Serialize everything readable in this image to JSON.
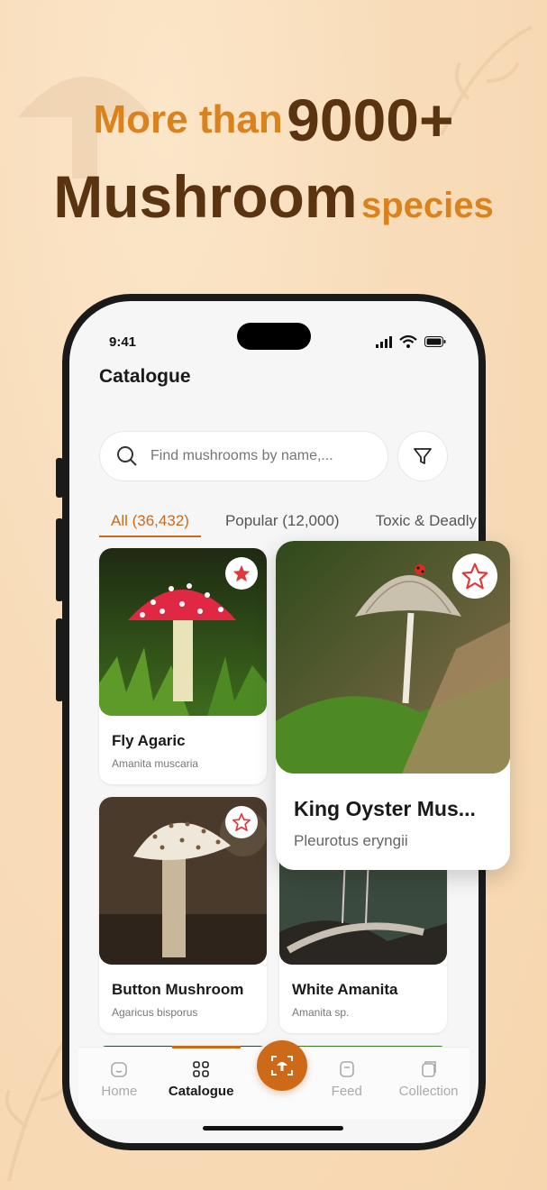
{
  "promo": {
    "line1_prefix": "More than",
    "line1_number": "9000+",
    "line2_main": "Mushroom",
    "line2_suffix": "species"
  },
  "status": {
    "time": "9:41"
  },
  "page": {
    "title": "Catalogue"
  },
  "search": {
    "placeholder": "Find mushrooms by name,..."
  },
  "tabs": [
    {
      "label": "All (36,432)",
      "active": true
    },
    {
      "label": "Popular (12,000)",
      "active": false
    },
    {
      "label": "Toxic & Deadly",
      "active": false
    }
  ],
  "cards": [
    {
      "name": "Fly Agaric",
      "scientific": "Amanita muscaria",
      "favorite": true
    },
    {
      "name": "Button Mushroom",
      "scientific": "Agaricus bisporus",
      "favorite": false
    },
    {
      "name": "White Amanita",
      "scientific": "Amanita sp.",
      "favorite": false
    }
  ],
  "featured": {
    "name": "King Oyster Mus...",
    "scientific": "Pleurotus eryngii",
    "favorite": false
  },
  "nav": [
    {
      "label": "Home",
      "icon": "home-icon"
    },
    {
      "label": "Catalogue",
      "icon": "grid-icon",
      "active": true
    },
    {
      "label": "Feed",
      "icon": "feed-icon"
    },
    {
      "label": "Collection",
      "icon": "collection-icon"
    }
  ],
  "colors": {
    "accent": "#cc6a1a",
    "brown": "#5a3411",
    "orange": "#d9821e"
  }
}
